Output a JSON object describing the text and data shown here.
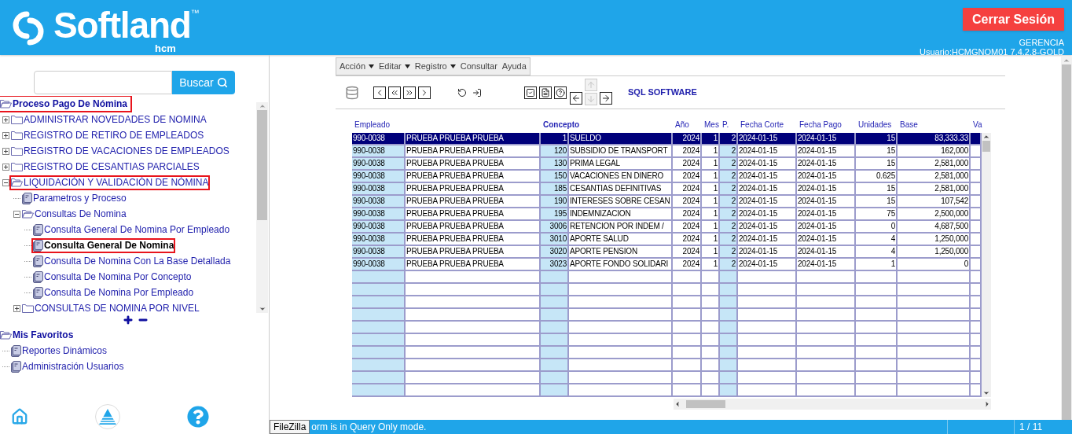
{
  "header": {
    "brand": "Softland",
    "trademark": "™",
    "product": "hcm",
    "logout": "Cerrar Sesión",
    "company": "GERENCIA",
    "user": "Usuario:HCMGNOM01 7.4.2.8-GOLD"
  },
  "search": {
    "button": "Buscar"
  },
  "navigation": {
    "label": "Proceso Pago De Nómina",
    "highlighted": true,
    "children": [
      {
        "label": "ADMINISTRAR NOVEDADES DE NOMINA",
        "kind": "folder",
        "expanded": false,
        "highlighted": false,
        "selected": false
      },
      {
        "label": "REGISTRO DE RETIRO DE EMPLEADOS",
        "kind": "folder",
        "expanded": false,
        "highlighted": false,
        "selected": false
      },
      {
        "label": "REGISTRO DE VACACIONES DE EMPLEADOS",
        "kind": "folder",
        "expanded": false,
        "highlighted": false,
        "selected": false
      },
      {
        "label": "REGISTRO DE CESANTIAS PARCIALES",
        "kind": "folder",
        "expanded": false,
        "highlighted": false,
        "selected": false
      },
      {
        "label": "LIQUIDACIÓN Y VALIDACIÓN DE NÓMINA",
        "kind": "folder",
        "expanded": true,
        "highlighted": true,
        "selected": false,
        "children": [
          {
            "label": "Parametros y Proceso",
            "kind": "document",
            "highlighted": false,
            "selected": false
          },
          {
            "label": "Consultas De Nomina",
            "kind": "folder",
            "expanded": true,
            "highlighted": false,
            "selected": false,
            "children": [
              {
                "label": "Consulta General De Nomina Por Empleado",
                "kind": "document",
                "highlighted": false,
                "selected": false
              },
              {
                "label": "Consulta General De Nomina",
                "kind": "document",
                "highlighted": true,
                "selected": true
              },
              {
                "label": "Consulta De Nomina Con La Base Detallada",
                "kind": "document",
                "highlighted": false,
                "selected": false
              },
              {
                "label": "Consulta De Nomina Por Concepto",
                "kind": "document",
                "highlighted": false,
                "selected": false
              },
              {
                "label": "Consulta De Nomina Por Empleado",
                "kind": "document",
                "highlighted": false,
                "selected": false
              }
            ]
          },
          {
            "label": "CONSULTAS DE NOMINA POR NIVEL",
            "kind": "folder",
            "expanded": false,
            "highlighted": false,
            "selected": false
          }
        ]
      }
    ]
  },
  "favorites": {
    "label": "Mis Favoritos",
    "highlighted": false,
    "children": [
      {
        "label": "Reportes Dinámicos",
        "kind": "document",
        "highlighted": false,
        "selected": false
      },
      {
        "label": "Administración Usuarios",
        "kind": "document",
        "highlighted": false,
        "selected": false
      }
    ]
  },
  "menu": [
    {
      "label": "Acción",
      "has_submenu": true
    },
    {
      "label": "Editar",
      "has_submenu": true
    },
    {
      "label": "Registro",
      "has_submenu": true
    },
    {
      "label": "Consultar",
      "has_submenu": false
    },
    {
      "label": "Ayuda",
      "has_submenu": false
    }
  ],
  "toolbar": {
    "groups": [
      [
        {
          "kind": "database",
          "disabled": false
        }
      ],
      [
        {
          "kind": "prev",
          "disabled": false
        },
        {
          "kind": "first",
          "disabled": false
        },
        {
          "kind": "last",
          "disabled": false
        },
        {
          "kind": "next",
          "disabled": false
        }
      ],
      [
        {
          "kind": "undo",
          "disabled": false
        },
        {
          "kind": "exit",
          "disabled": false
        }
      ],
      [
        {
          "kind": "check",
          "disabled": false
        },
        {
          "kind": "form",
          "disabled": false
        },
        {
          "kind": "help",
          "disabled": false
        }
      ],
      [
        {
          "kind": "left",
          "disabled": false
        },
        {
          "kind": "up",
          "disabled": true
        },
        {
          "kind": "down",
          "disabled": true
        },
        {
          "kind": "right",
          "disabled": false
        }
      ]
    ],
    "label": "SQL SOFTWARE"
  },
  "grid": {
    "columns": [
      {
        "label": "Empleado",
        "kind": "text"
      },
      {
        "kind": "text"
      },
      {
        "label": "Concepto",
        "kind": "number"
      },
      {
        "kind": "text"
      },
      {
        "label": "Año",
        "kind": "number"
      },
      {
        "label": "Mes",
        "kind": "number"
      },
      {
        "label": "P.",
        "kind": "number"
      },
      {
        "label": "Fecha Corte",
        "kind": "text"
      },
      {
        "label": "Fecha Pago",
        "kind": "text"
      },
      {
        "label": "Unidades",
        "kind": "number"
      },
      {
        "label": "Base",
        "kind": "number"
      },
      {
        "label": "Va",
        "kind": "number"
      }
    ],
    "rows": [
      {
        "selected": true,
        "cells": [
          "990-0038",
          "PRUEBA PRUEBA PRUEBA",
          "1",
          "SUELDO",
          "2024",
          "1",
          "2",
          "2024-01-15",
          "2024-01-15",
          "15",
          "83,333.33"
        ]
      },
      {
        "selected": false,
        "cells": [
          "990-0038",
          "PRUEBA PRUEBA PRUEBA",
          "120",
          "SUBSIDIO DE TRANSPORT",
          "2024",
          "1",
          "2",
          "2024-01-15",
          "2024-01-15",
          "15",
          "162,000"
        ]
      },
      {
        "selected": false,
        "cells": [
          "990-0038",
          "PRUEBA PRUEBA PRUEBA",
          "130",
          "PRIMA LEGAL",
          "2024",
          "1",
          "2",
          "2024-01-15",
          "2024-01-15",
          "15",
          "2,581,000"
        ]
      },
      {
        "selected": false,
        "cells": [
          "990-0038",
          "PRUEBA PRUEBA PRUEBA",
          "150",
          "VACACIONES EN DINERO",
          "2024",
          "1",
          "2",
          "2024-01-15",
          "2024-01-15",
          "0.625",
          "2,581,000"
        ]
      },
      {
        "selected": false,
        "cells": [
          "990-0038",
          "PRUEBA PRUEBA PRUEBA",
          "185",
          "CESANTIAS DEFINITIVAS",
          "2024",
          "1",
          "2",
          "2024-01-15",
          "2024-01-15",
          "15",
          "2,581,000"
        ]
      },
      {
        "selected": false,
        "cells": [
          "990-0038",
          "PRUEBA PRUEBA PRUEBA",
          "190",
          "INTERESES SOBRE CESAN",
          "2024",
          "1",
          "2",
          "2024-01-15",
          "2024-01-15",
          "15",
          "107,542"
        ]
      },
      {
        "selected": false,
        "cells": [
          "990-0038",
          "PRUEBA PRUEBA PRUEBA",
          "195",
          "INDEMNIZACION",
          "2024",
          "1",
          "2",
          "2024-01-15",
          "2024-01-15",
          "75",
          "2,500,000"
        ]
      },
      {
        "selected": false,
        "cells": [
          "990-0038",
          "PRUEBA PRUEBA PRUEBA",
          "3006",
          "RETENCION POR INDEM /",
          "2024",
          "1",
          "2",
          "2024-01-15",
          "2024-01-15",
          "0",
          "4,687,500"
        ]
      },
      {
        "selected": false,
        "cells": [
          "990-0038",
          "PRUEBA PRUEBA PRUEBA",
          "3010",
          "APORTE SALUD",
          "2024",
          "1",
          "2",
          "2024-01-15",
          "2024-01-15",
          "4",
          "1,250,000"
        ]
      },
      {
        "selected": false,
        "cells": [
          "990-0038",
          "PRUEBA PRUEBA PRUEBA",
          "3020",
          "APORTE PENSION",
          "2024",
          "1",
          "2",
          "2024-01-15",
          "2024-01-15",
          "4",
          "1,250,000"
        ]
      },
      {
        "selected": false,
        "cells": [
          "990-0038",
          "PRUEBA PRUEBA PRUEBA",
          "3023",
          "APORTE FONDO SOLIDARI",
          "2024",
          "1",
          "2",
          "2024-01-15",
          "2024-01-15",
          "1",
          "0"
        ]
      }
    ]
  },
  "status_bar": {
    "tooltip": "FileZilla",
    "message": "orm is in Query Only mode.",
    "record": "1 / 11"
  }
}
